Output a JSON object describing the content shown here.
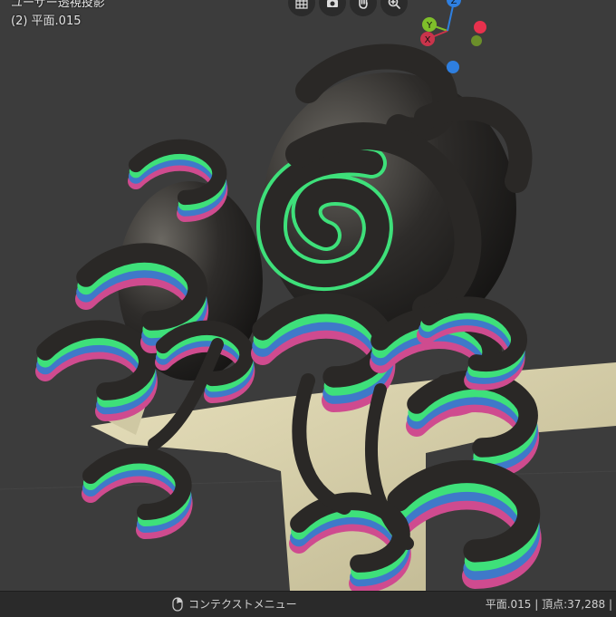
{
  "viewport": {
    "mode_text": "ユーザー透視投影",
    "object_text": "(2) 平面.015"
  },
  "nav_icons": [
    "grid-icon",
    "camera-icon",
    "hand-icon",
    "zoom-icon"
  ],
  "gizmo": {
    "x_label": "X",
    "y_label": "Y",
    "z_label": "Z",
    "colors": {
      "x": "#c9344b",
      "y": "#7fbf2a",
      "z": "#2e7fe0"
    }
  },
  "statusbar": {
    "context_menu_label": "コンテクストメニュー",
    "stats": "平面.015 | 頂点:37,288 |"
  },
  "colors": {
    "background": "#3c3c3c",
    "body": "#d9d3b0",
    "hair": "#2a2826",
    "stripe_green": "#3ee07a",
    "stripe_blue": "#3f79c9",
    "stripe_pink": "#c94a8f"
  }
}
